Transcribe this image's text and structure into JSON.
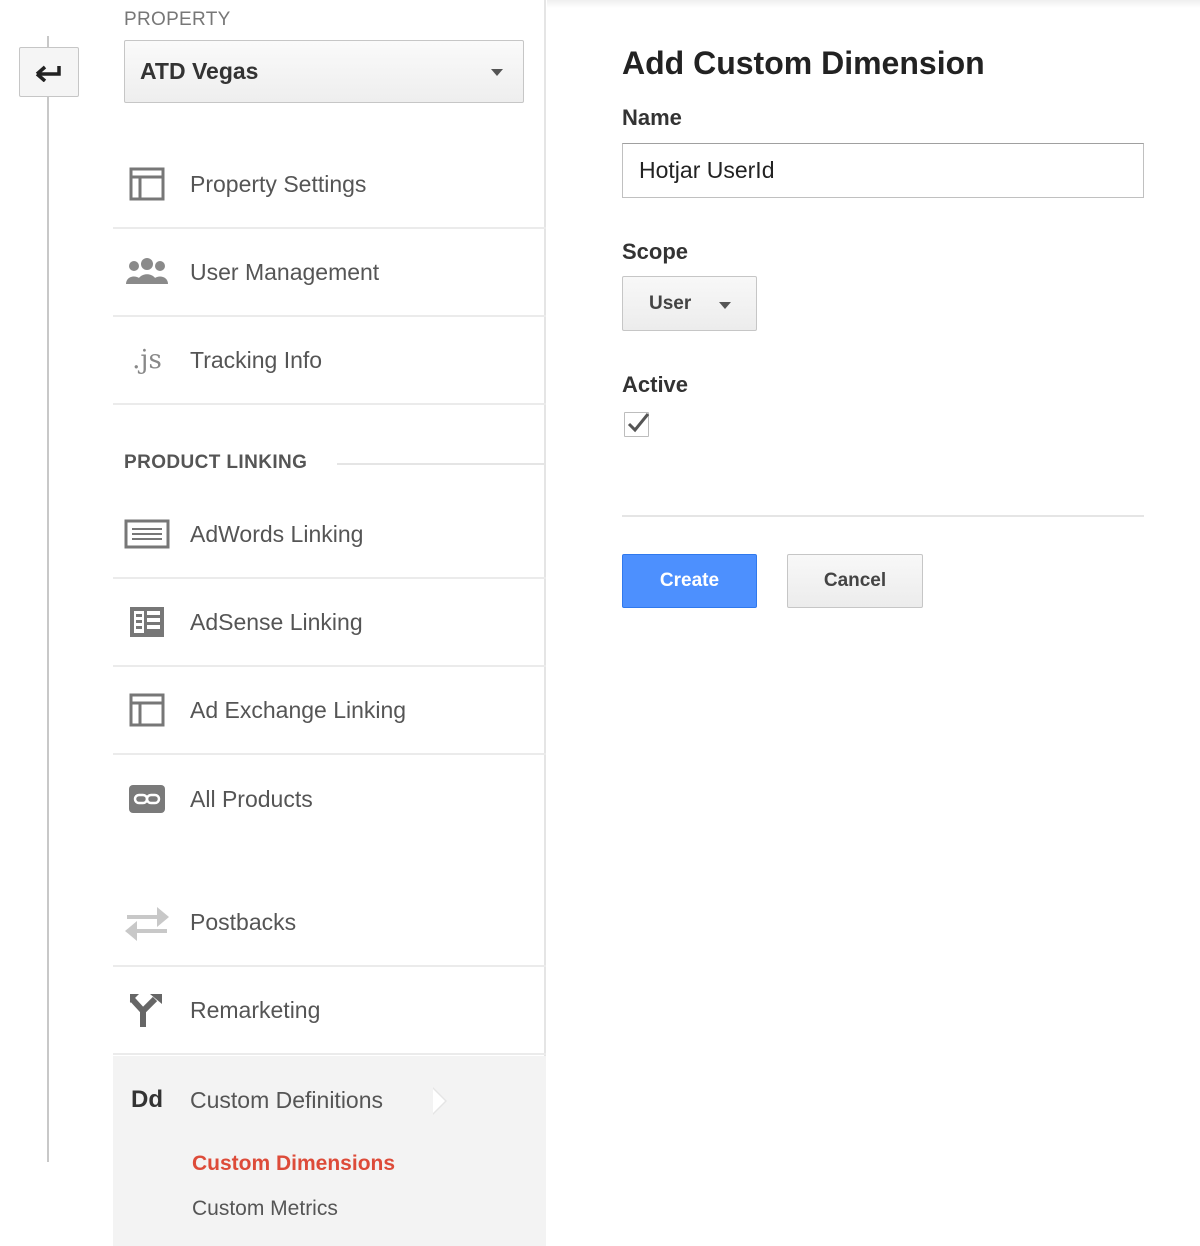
{
  "property": {
    "label": "PROPERTY",
    "selected": "ATD Vegas"
  },
  "nav": {
    "items": [
      {
        "label": "Property Settings",
        "icon": "layout-icon"
      },
      {
        "label": "User Management",
        "icon": "users-icon"
      },
      {
        "label": "Tracking Info",
        "icon": "js-icon",
        "glyph": ".js"
      }
    ],
    "section_product_linking": "PRODUCT LINKING",
    "linking_items": [
      {
        "label": "AdWords Linking",
        "icon": "adwords-icon"
      },
      {
        "label": "AdSense Linking",
        "icon": "adsense-icon"
      },
      {
        "label": "Ad Exchange Linking",
        "icon": "layout-icon"
      },
      {
        "label": "All Products",
        "icon": "link-icon"
      }
    ],
    "other_items": [
      {
        "label": "Postbacks",
        "icon": "postbacks-icon"
      },
      {
        "label": "Remarketing",
        "icon": "remarketing-icon"
      }
    ],
    "custom_definitions": {
      "label": "Custom Definitions",
      "glyph": "Dd",
      "sub_items": [
        {
          "label": "Custom Dimensions",
          "active": true
        },
        {
          "label": "Custom Metrics",
          "active": false
        }
      ]
    }
  },
  "form": {
    "title": "Add Custom Dimension",
    "name_label": "Name",
    "name_value": "Hotjar UserId",
    "scope_label": "Scope",
    "scope_value": "User",
    "active_label": "Active",
    "active_checked": true,
    "create_label": "Create",
    "cancel_label": "Cancel"
  },
  "colors": {
    "accent_blue": "#4d90fe",
    "active_red": "#dd4b39",
    "icon_gray": "#777777"
  }
}
